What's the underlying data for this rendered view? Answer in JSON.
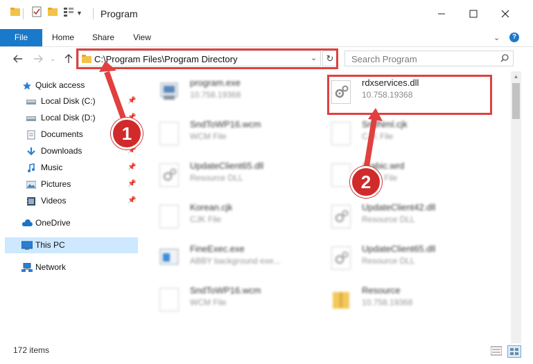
{
  "window": {
    "title": "Program",
    "controls": [
      "minimize-icon",
      "maximize-icon",
      "close-icon"
    ]
  },
  "ribbon": {
    "tabs": [
      "File",
      "Home",
      "Share",
      "View"
    ]
  },
  "address_bar": {
    "path": "C:\\Program Files\\Program Directory"
  },
  "search": {
    "placeholder": "Search Program"
  },
  "sidebar": {
    "items": [
      {
        "label": "Quick access",
        "icon": "star-icon"
      },
      {
        "label": "Local Disk (C:)",
        "icon": "drive-icon",
        "pinned": true
      },
      {
        "label": "Local Disk (D:)",
        "icon": "drive-icon",
        "pinned": true
      },
      {
        "label": "Documents",
        "icon": "documents-icon",
        "pinned": true
      },
      {
        "label": "Downloads",
        "icon": "download-icon",
        "pinned": true
      },
      {
        "label": "Music",
        "icon": "music-icon",
        "pinned": true
      },
      {
        "label": "Pictures",
        "icon": "pictures-icon",
        "pinned": true
      },
      {
        "label": "Videos",
        "icon": "videos-icon",
        "pinned": true
      },
      {
        "label": "OneDrive",
        "icon": "cloud-icon"
      },
      {
        "label": "This PC",
        "icon": "computer-icon",
        "selected": true
      },
      {
        "label": "Network",
        "icon": "network-icon"
      }
    ]
  },
  "files": [
    {
      "name": "program.exe",
      "detail": "10.758.19368"
    },
    {
      "name": "rdxservices.dll",
      "detail": "10.758.19368"
    },
    {
      "name": "SndToWP16.wcm",
      "detail": "WCM File"
    },
    {
      "name": "SndNml.cjk",
      "detail": "CJK File"
    },
    {
      "name": "UpdateClient65.dll",
      "detail": "Resource DLL"
    },
    {
      "name": "Arabic.wrd",
      "detail": "WRD File"
    },
    {
      "name": "Korean.cjk",
      "detail": "CJK File"
    },
    {
      "name": "UpdateClient42.dll",
      "detail": "Resource DLL"
    },
    {
      "name": "FineExec.exe",
      "detail": "ABBY background exe..."
    },
    {
      "name": "UpdateClient65.dll",
      "detail": "Resource DLL"
    },
    {
      "name": "SndToWP16.wcm",
      "detail": "WCM File"
    },
    {
      "name": "Resource",
      "detail": "10.758.19368"
    }
  ],
  "annotations": {
    "step1": "1",
    "step2": "2",
    "color": "#e0403f"
  },
  "status": {
    "count": "172 items"
  },
  "colors": {
    "accent": "#1979ca",
    "selected_bg": "#cde8ff"
  }
}
